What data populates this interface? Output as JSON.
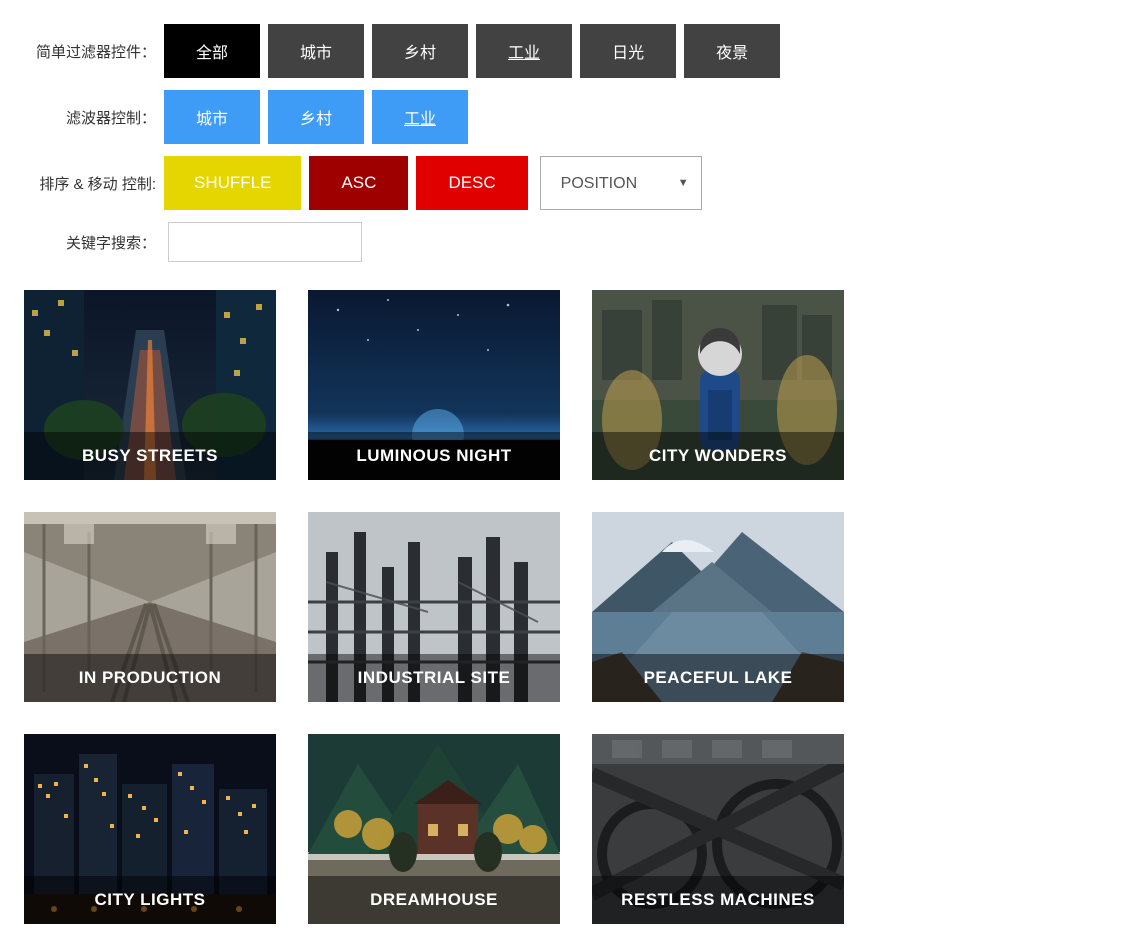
{
  "labels": {
    "simple_filter": "简单过滤器控件：",
    "filter_control": "滤波器控制：",
    "sort_move": "排序 & 移动 控制:",
    "keyword_search": "关键字搜索："
  },
  "simple_filters": [
    {
      "label": "全部",
      "active": true,
      "underline": false
    },
    {
      "label": "城市",
      "active": false,
      "underline": false
    },
    {
      "label": "乡村",
      "active": false,
      "underline": false
    },
    {
      "label": "工业",
      "active": false,
      "underline": true
    },
    {
      "label": "日光",
      "active": false,
      "underline": false
    },
    {
      "label": "夜景",
      "active": false,
      "underline": false
    }
  ],
  "multi_filters": [
    {
      "label": "城市",
      "underline": false
    },
    {
      "label": "乡村",
      "underline": false
    },
    {
      "label": "工业",
      "underline": true
    }
  ],
  "sort_buttons": {
    "shuffle": "SHUFFLE",
    "asc": "ASC",
    "desc": "DESC"
  },
  "sort_select": {
    "selected": "POSITION",
    "options": [
      "POSITION"
    ]
  },
  "search_value": "",
  "cards": [
    {
      "title": "BUSY STREETS",
      "svg_key": "busy-streets"
    },
    {
      "title": "LUMINOUS NIGHT",
      "svg_key": "luminous-night"
    },
    {
      "title": "CITY WONDERS",
      "svg_key": "city-wonders"
    },
    {
      "title": "IN PRODUCTION",
      "svg_key": "in-production"
    },
    {
      "title": "INDUSTRIAL SITE",
      "svg_key": "industrial-site"
    },
    {
      "title": "PEACEFUL LAKE",
      "svg_key": "peaceful-lake"
    },
    {
      "title": "CITY LIGHTS",
      "svg_key": "city-lights"
    },
    {
      "title": "DREAMHOUSE",
      "svg_key": "dreamhouse"
    },
    {
      "title": "RESTLESS MACHINES",
      "svg_key": "restless-machines"
    }
  ]
}
